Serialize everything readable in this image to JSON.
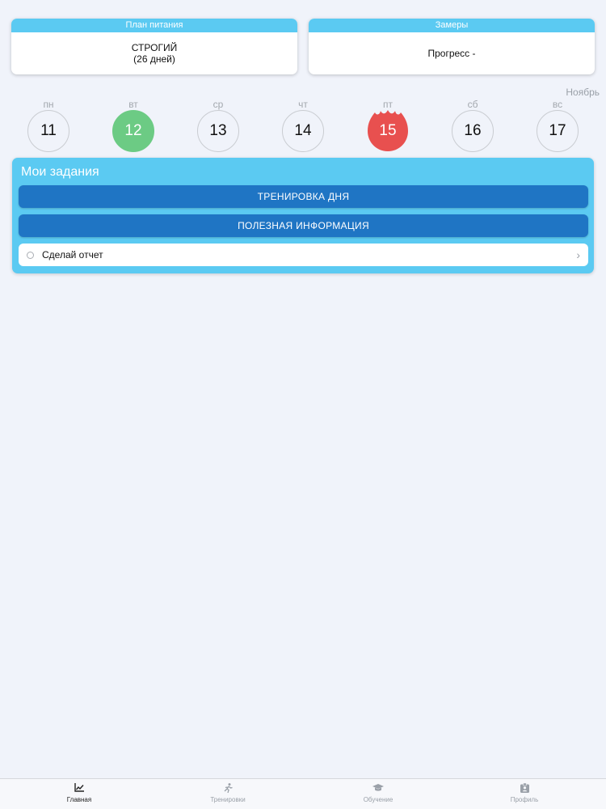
{
  "nutrition_card": {
    "header": "План питания",
    "plan_name": "СТРОГИЙ",
    "plan_days": "(26 дней)"
  },
  "measure_card": {
    "header": "Замеры",
    "progress": "Прогресс -"
  },
  "calendar": {
    "month": "Ноябрь",
    "days": [
      {
        "name": "пн",
        "date": "11",
        "state": "normal"
      },
      {
        "name": "вт",
        "date": "12",
        "state": "completed"
      },
      {
        "name": "ср",
        "date": "13",
        "state": "normal"
      },
      {
        "name": "чт",
        "date": "14",
        "state": "normal"
      },
      {
        "name": "пт",
        "date": "15",
        "state": "today"
      },
      {
        "name": "сб",
        "date": "16",
        "state": "normal"
      },
      {
        "name": "вс",
        "date": "17",
        "state": "normal"
      }
    ],
    "colors": {
      "completed": "#6ccb84",
      "today": "#e8504f"
    }
  },
  "tasks": {
    "title": "Мои задания",
    "workout_label": "ТРЕНИРОВКА ДНЯ",
    "info_label": "ПОЛЕЗНАЯ ИНФОРМАЦИЯ",
    "report_label": "Сделай отчет",
    "report_chevron": "›"
  },
  "tabbar": {
    "tabs": [
      {
        "label": "Главная",
        "icon": "chart-icon",
        "active": true
      },
      {
        "label": "Тренировки",
        "icon": "running-icon",
        "active": false
      },
      {
        "label": "Обучение",
        "icon": "graduation-cap-icon",
        "active": false
      },
      {
        "label": "Профиль",
        "icon": "profile-badge-icon",
        "active": false
      }
    ]
  },
  "colors": {
    "accent": "#5bcaf2",
    "button": "#1f75c4",
    "background": "#f0f3fa"
  }
}
